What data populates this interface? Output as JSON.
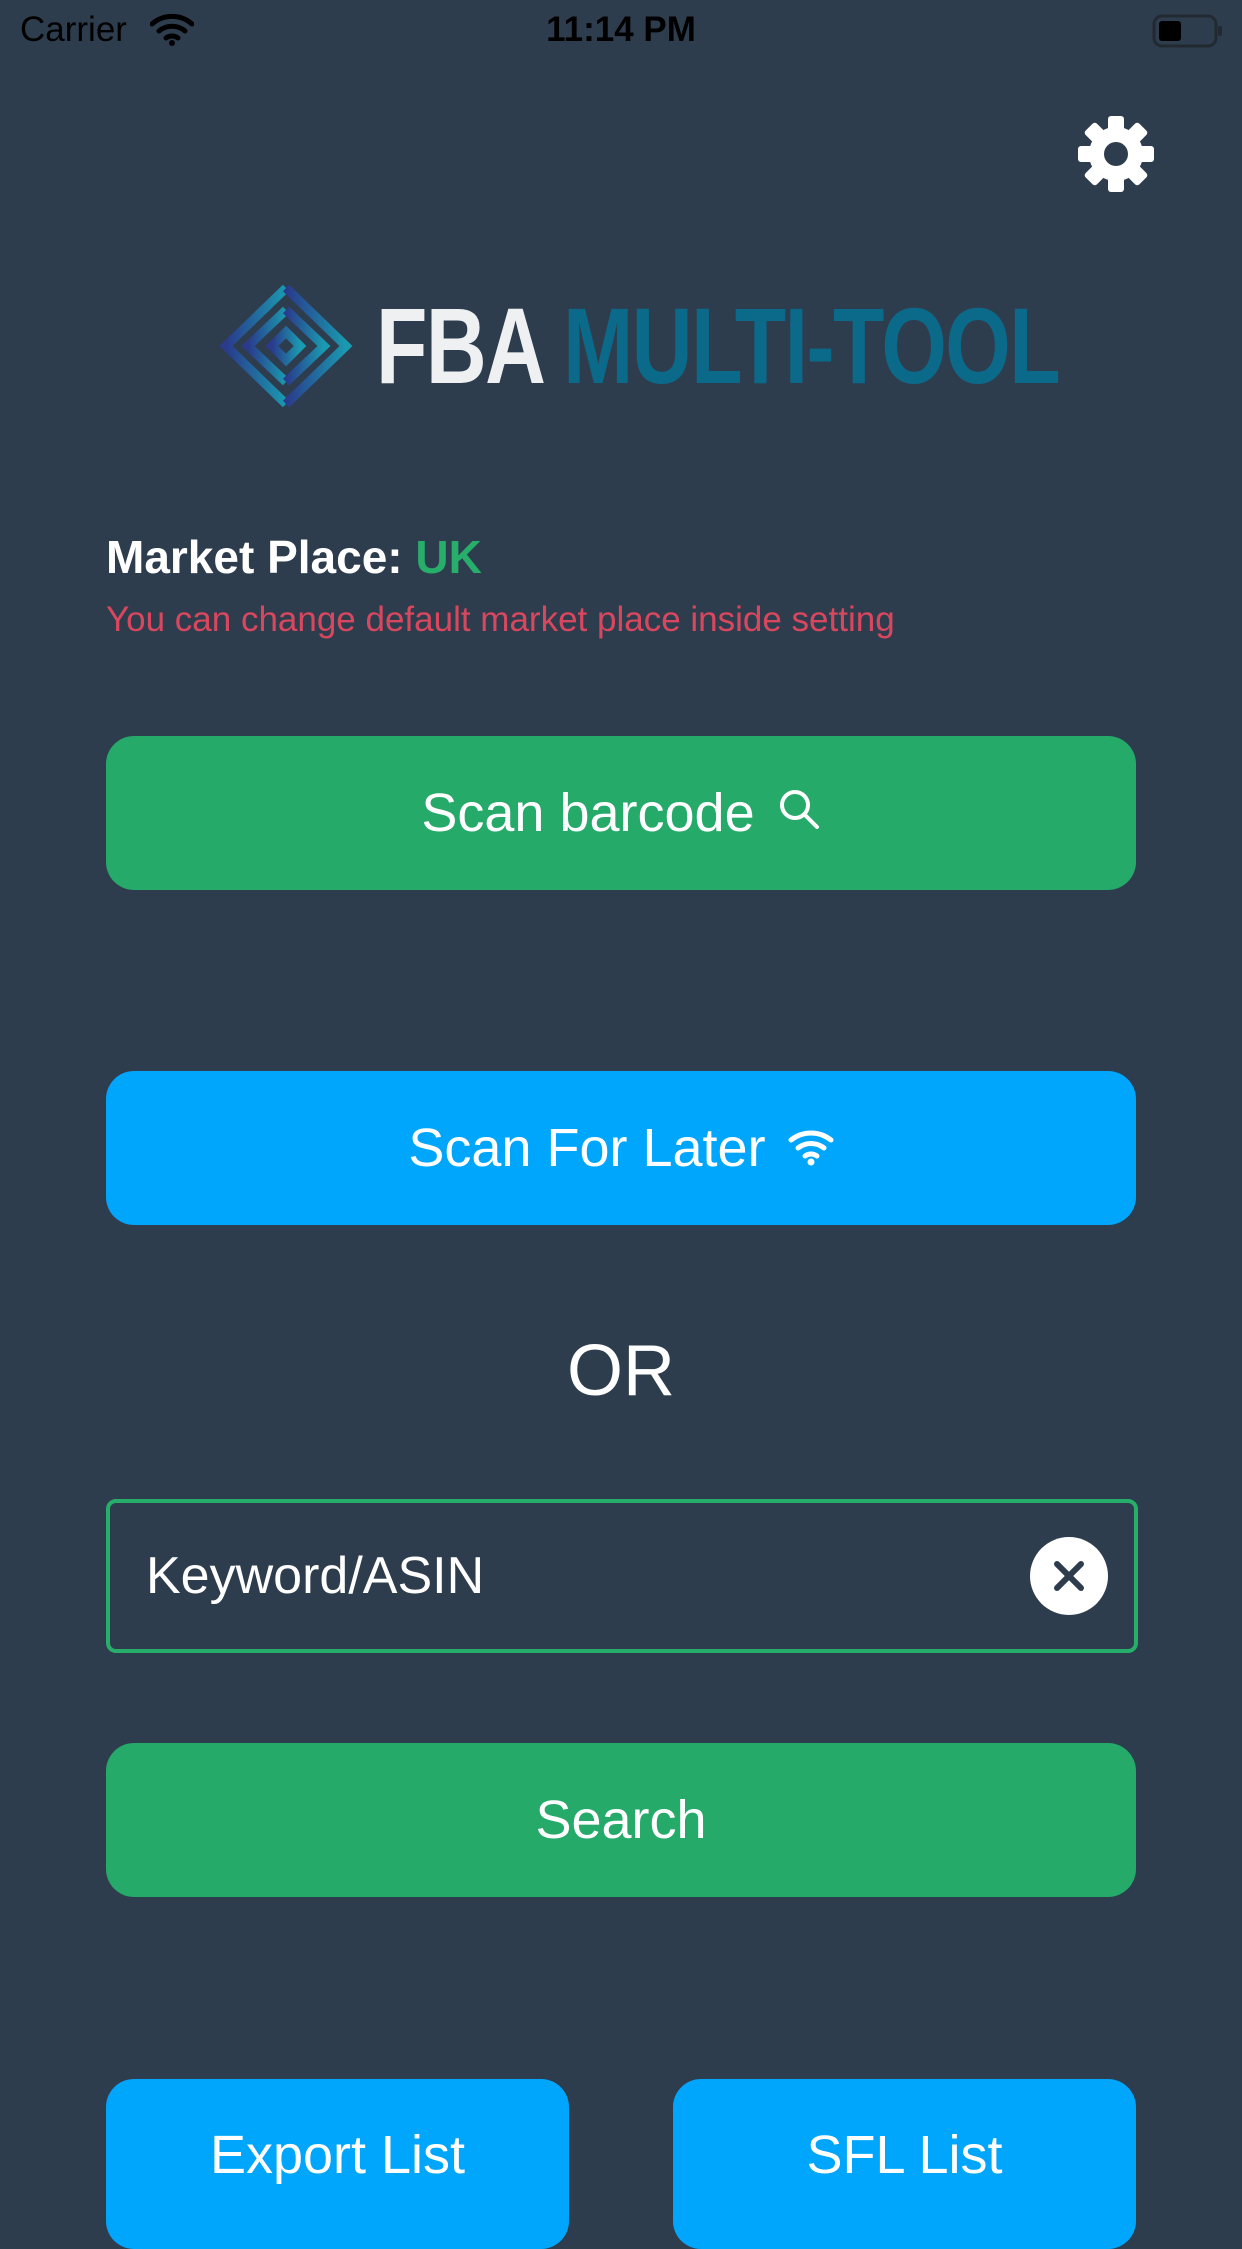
{
  "status_bar": {
    "carrier": "Carrier",
    "time": "11:14 PM",
    "icons": [
      "wifi-icon",
      "battery-icon"
    ]
  },
  "header": {
    "settings_icon": "gear-icon"
  },
  "logo": {
    "text_primary": "FBA",
    "text_secondary": "MULTI-TOOL",
    "colors": {
      "primary": "#eef0f2",
      "secondary": "#0b6a8a"
    }
  },
  "market": {
    "label": "Market Place:",
    "value": "UK",
    "hint": "You can change default market place inside setting"
  },
  "buttons": {
    "scan_barcode": "Scan barcode",
    "scan_for_later": "Scan For Later",
    "search": "Search",
    "export_list": "Export List",
    "sfl_list": "SFL List"
  },
  "divider_text": "OR",
  "search": {
    "placeholder": "Keyword/ASIN",
    "value": ""
  },
  "colors": {
    "background": "#2e3d4e",
    "green": "#25aa69",
    "blue": "#00a6fc",
    "hint_red": "#d9475f"
  }
}
